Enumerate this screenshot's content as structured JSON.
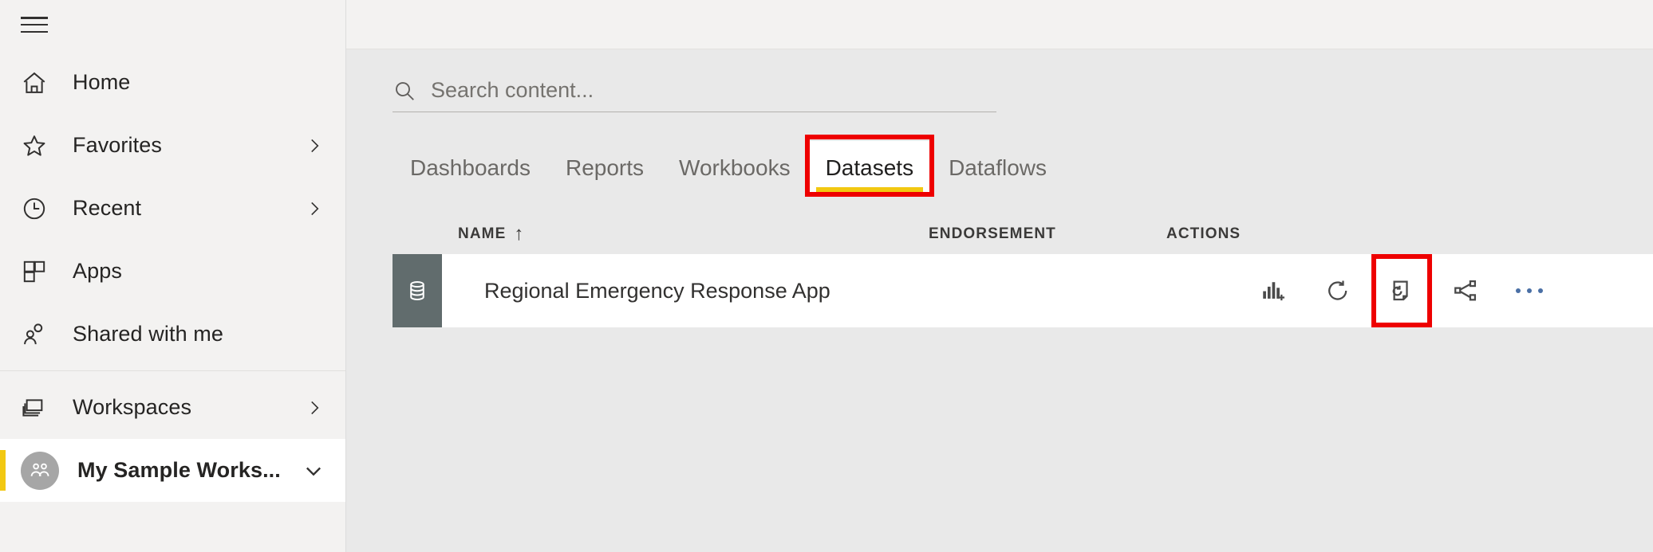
{
  "sidebar": {
    "menu_button": "menu-hamburger",
    "groups": [
      {
        "items": [
          {
            "label": "Home",
            "icon": "home-icon",
            "chevron": false
          },
          {
            "label": "Favorites",
            "icon": "star-icon",
            "chevron": true
          },
          {
            "label": "Recent",
            "icon": "clock-icon",
            "chevron": true
          },
          {
            "label": "Apps",
            "icon": "apps-grid-icon",
            "chevron": false
          },
          {
            "label": "Shared with me",
            "icon": "people-icon",
            "chevron": false
          }
        ]
      },
      {
        "items": [
          {
            "label": "Workspaces",
            "icon": "workspaces-stack-icon",
            "chevron": true
          }
        ]
      }
    ],
    "selected_workspace": {
      "label": "My Sample Works...",
      "icon": "group-avatar-icon",
      "chevron": "chevron-down",
      "accent_color": "#f2c811"
    }
  },
  "search": {
    "placeholder": "Search content...",
    "value": "",
    "icon": "search-icon"
  },
  "tabs": [
    {
      "label": "Dashboards",
      "active": false
    },
    {
      "label": "Reports",
      "active": false
    },
    {
      "label": "Workbooks",
      "active": false
    },
    {
      "label": "Datasets",
      "active": true
    },
    {
      "label": "Dataflows",
      "active": false
    }
  ],
  "table": {
    "columns": {
      "name": "NAME",
      "name_sort": "↑",
      "endorsement": "ENDORSEMENT",
      "actions": "ACTIONS"
    },
    "rows": [
      {
        "name": "Regional Emergency Response App",
        "tile_icon": "database-icon",
        "tile_color": "#616c6d",
        "endorsement": "",
        "actions": [
          {
            "name": "create-report-icon",
            "title": "Create report"
          },
          {
            "name": "refresh-now-icon",
            "title": "Refresh now"
          },
          {
            "name": "schedule-refresh-icon",
            "title": "Schedule refresh"
          },
          {
            "name": "share-icon",
            "title": "Share"
          },
          {
            "name": "more-options-icon",
            "title": "More options"
          }
        ]
      }
    ]
  },
  "annotations": [
    {
      "name": "datasets-tab-highlight",
      "color": "#ee0000",
      "target": "Datasets"
    },
    {
      "name": "schedule-refresh-highlight",
      "color": "#ee0000",
      "target": "Schedule refresh"
    }
  ],
  "theme": {
    "accent": "#f2c811",
    "sidebar_bg": "#f3f2f1",
    "content_bg": "#e9e9e9",
    "row_bg": "#ffffff",
    "annotation": "#ee0000"
  }
}
